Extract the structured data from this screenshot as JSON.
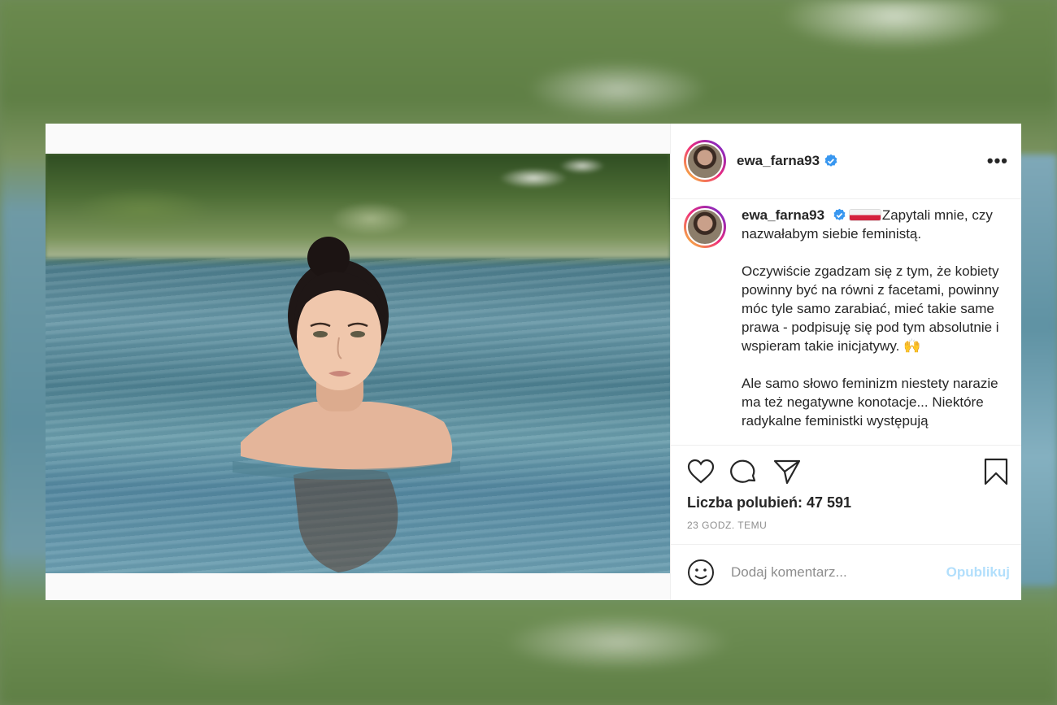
{
  "post": {
    "username": "ewa_farna93",
    "more_icon": "more-options-icon",
    "caption": {
      "username": "ewa_farna93",
      "flag": "poland-flag",
      "p1": "Zapytali mnie, czy nazwałabym siebie feministą.",
      "p2": "Oczywiście zgadzam się z tym, że kobiety powinny być na równi z facetami, powinny móc tyle samo zarabiać, mieć takie same prawa - podpisuję się pod tym absolutnie i wspieram takie inicjatywy. 🙌",
      "p3": "Ale samo słowo feminizm niestety narazie ma też negatywne konotacje... Niektóre radykalne feministki występują"
    },
    "likes_text": "Liczba polubień: 47 591",
    "time_text": "23 GODZ. TEMU",
    "comment": {
      "placeholder": "Dodaj komentarz...",
      "publish_label": "Opublikuj"
    },
    "icons": [
      "heart-icon",
      "comment-icon",
      "share-icon",
      "bookmark-icon",
      "emoji-icon",
      "verified-badge-icon"
    ]
  },
  "colors": {
    "verified": "#3897f0",
    "publish_disabled": "#b2dffc",
    "muted": "#8e8e8e"
  }
}
